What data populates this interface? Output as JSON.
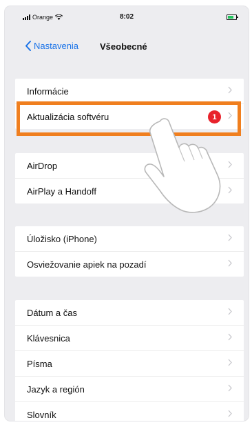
{
  "status_bar": {
    "carrier": "Orange",
    "time": "8:02"
  },
  "nav": {
    "back_label": "Nastavenia",
    "title": "Všeobecné"
  },
  "groups": [
    {
      "rows": [
        {
          "label": "Informácie"
        },
        {
          "label": "Aktualizácia softvéru",
          "badge": "1"
        }
      ]
    },
    {
      "rows": [
        {
          "label": "AirDrop"
        },
        {
          "label": "AirPlay a Handoff"
        }
      ]
    },
    {
      "rows": [
        {
          "label": "Úložisko (iPhone)"
        },
        {
          "label": "Osviežovanie apiek na pozadí"
        }
      ]
    },
    {
      "rows": [
        {
          "label": "Dátum a čas"
        },
        {
          "label": "Klávesnica"
        },
        {
          "label": "Písma"
        },
        {
          "label": "Jazyk a región"
        },
        {
          "label": "Slovník"
        }
      ]
    }
  ],
  "icons": {
    "back": "chevron-left-icon",
    "row_disclosure": "chevron-right-icon",
    "signal": "signal-icon",
    "wifi": "wifi-icon",
    "battery": "battery-icon",
    "pointer": "hand-pointer-icon"
  },
  "colors": {
    "accent": "#1a73e8",
    "badge": "#e8222b",
    "highlight": "#f07f1f",
    "battery": "#22c55e"
  }
}
